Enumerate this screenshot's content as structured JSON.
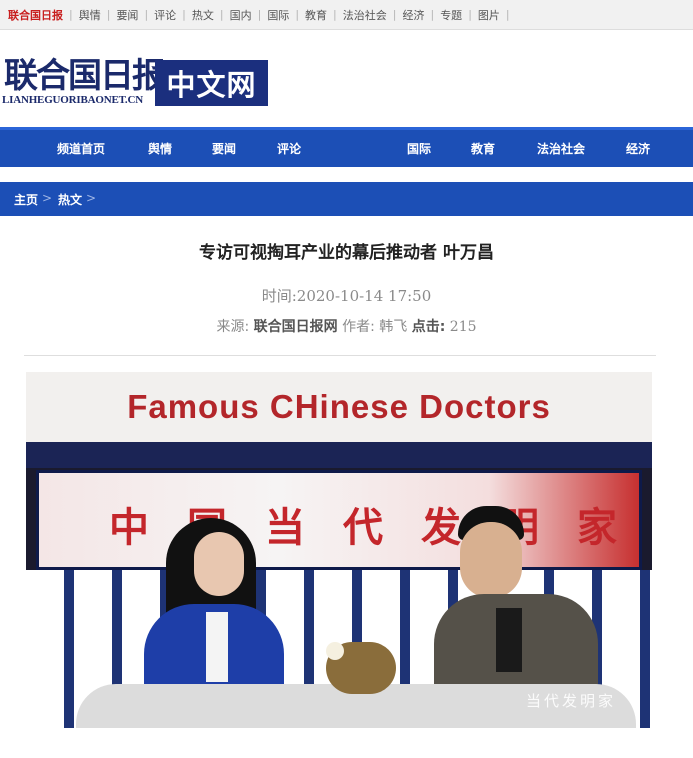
{
  "topbar": {
    "brand": "联合国日报",
    "links": [
      "舆情",
      "要闻",
      "评论",
      "热文",
      "国内",
      "国际",
      "教育",
      "法治社会",
      "经济",
      "专题",
      "图片"
    ]
  },
  "logo": {
    "cn": "联合国日报",
    "en": "LIANHEGUORIBAONET.CN",
    "box": "中文网"
  },
  "nav": {
    "items": [
      "频道首页",
      "舆情",
      "要闻",
      "评论",
      "国际",
      "教育",
      "法治社会",
      "经济"
    ]
  },
  "breadcrumb": {
    "home": "主页",
    "sep": ">",
    "section": "热文"
  },
  "article": {
    "title": "专访可视掏耳产业的幕后推动者 叶万昌",
    "time_label": "时间:",
    "time_value": "2020-10-14 17:50",
    "source_label": "来源:",
    "source_value": "联合国日报网",
    "author_label": "作者:",
    "author_value": "韩飞",
    "clicks_label": "点击:",
    "clicks_value": "215"
  },
  "photo": {
    "banner": "Famous CHinese Doctors",
    "screen_text": "中国当代发明家",
    "watermark": "当代发明家"
  },
  "colors": {
    "nav_blue": "#1c4fb6",
    "logo_navy": "#1b2f7e",
    "brand_red": "#c81e1e"
  }
}
